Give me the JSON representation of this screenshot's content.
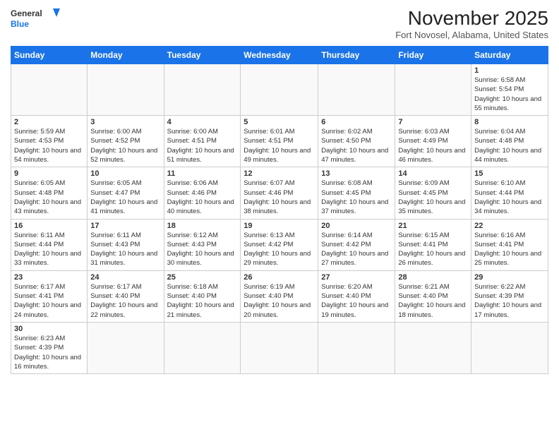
{
  "logo": {
    "line1": "General",
    "line2": "Blue"
  },
  "title": "November 2025",
  "location": "Fort Novosel, Alabama, United States",
  "days_of_week": [
    "Sunday",
    "Monday",
    "Tuesday",
    "Wednesday",
    "Thursday",
    "Friday",
    "Saturday"
  ],
  "weeks": [
    [
      {
        "day": "",
        "info": ""
      },
      {
        "day": "",
        "info": ""
      },
      {
        "day": "",
        "info": ""
      },
      {
        "day": "",
        "info": ""
      },
      {
        "day": "",
        "info": ""
      },
      {
        "day": "",
        "info": ""
      },
      {
        "day": "1",
        "info": "Sunrise: 6:58 AM\nSunset: 5:54 PM\nDaylight: 10 hours and 55 minutes."
      }
    ],
    [
      {
        "day": "2",
        "info": "Sunrise: 5:59 AM\nSunset: 4:53 PM\nDaylight: 10 hours and 54 minutes."
      },
      {
        "day": "3",
        "info": "Sunrise: 6:00 AM\nSunset: 4:52 PM\nDaylight: 10 hours and 52 minutes."
      },
      {
        "day": "4",
        "info": "Sunrise: 6:00 AM\nSunset: 4:51 PM\nDaylight: 10 hours and 51 minutes."
      },
      {
        "day": "5",
        "info": "Sunrise: 6:01 AM\nSunset: 4:51 PM\nDaylight: 10 hours and 49 minutes."
      },
      {
        "day": "6",
        "info": "Sunrise: 6:02 AM\nSunset: 4:50 PM\nDaylight: 10 hours and 47 minutes."
      },
      {
        "day": "7",
        "info": "Sunrise: 6:03 AM\nSunset: 4:49 PM\nDaylight: 10 hours and 46 minutes."
      },
      {
        "day": "8",
        "info": "Sunrise: 6:04 AM\nSunset: 4:48 PM\nDaylight: 10 hours and 44 minutes."
      }
    ],
    [
      {
        "day": "9",
        "info": "Sunrise: 6:05 AM\nSunset: 4:48 PM\nDaylight: 10 hours and 43 minutes."
      },
      {
        "day": "10",
        "info": "Sunrise: 6:05 AM\nSunset: 4:47 PM\nDaylight: 10 hours and 41 minutes."
      },
      {
        "day": "11",
        "info": "Sunrise: 6:06 AM\nSunset: 4:46 PM\nDaylight: 10 hours and 40 minutes."
      },
      {
        "day": "12",
        "info": "Sunrise: 6:07 AM\nSunset: 4:46 PM\nDaylight: 10 hours and 38 minutes."
      },
      {
        "day": "13",
        "info": "Sunrise: 6:08 AM\nSunset: 4:45 PM\nDaylight: 10 hours and 37 minutes."
      },
      {
        "day": "14",
        "info": "Sunrise: 6:09 AM\nSunset: 4:45 PM\nDaylight: 10 hours and 35 minutes."
      },
      {
        "day": "15",
        "info": "Sunrise: 6:10 AM\nSunset: 4:44 PM\nDaylight: 10 hours and 34 minutes."
      }
    ],
    [
      {
        "day": "16",
        "info": "Sunrise: 6:11 AM\nSunset: 4:44 PM\nDaylight: 10 hours and 33 minutes."
      },
      {
        "day": "17",
        "info": "Sunrise: 6:11 AM\nSunset: 4:43 PM\nDaylight: 10 hours and 31 minutes."
      },
      {
        "day": "18",
        "info": "Sunrise: 6:12 AM\nSunset: 4:43 PM\nDaylight: 10 hours and 30 minutes."
      },
      {
        "day": "19",
        "info": "Sunrise: 6:13 AM\nSunset: 4:42 PM\nDaylight: 10 hours and 29 minutes."
      },
      {
        "day": "20",
        "info": "Sunrise: 6:14 AM\nSunset: 4:42 PM\nDaylight: 10 hours and 27 minutes."
      },
      {
        "day": "21",
        "info": "Sunrise: 6:15 AM\nSunset: 4:41 PM\nDaylight: 10 hours and 26 minutes."
      },
      {
        "day": "22",
        "info": "Sunrise: 6:16 AM\nSunset: 4:41 PM\nDaylight: 10 hours and 25 minutes."
      }
    ],
    [
      {
        "day": "23",
        "info": "Sunrise: 6:17 AM\nSunset: 4:41 PM\nDaylight: 10 hours and 24 minutes."
      },
      {
        "day": "24",
        "info": "Sunrise: 6:17 AM\nSunset: 4:40 PM\nDaylight: 10 hours and 22 minutes."
      },
      {
        "day": "25",
        "info": "Sunrise: 6:18 AM\nSunset: 4:40 PM\nDaylight: 10 hours and 21 minutes."
      },
      {
        "day": "26",
        "info": "Sunrise: 6:19 AM\nSunset: 4:40 PM\nDaylight: 10 hours and 20 minutes."
      },
      {
        "day": "27",
        "info": "Sunrise: 6:20 AM\nSunset: 4:40 PM\nDaylight: 10 hours and 19 minutes."
      },
      {
        "day": "28",
        "info": "Sunrise: 6:21 AM\nSunset: 4:40 PM\nDaylight: 10 hours and 18 minutes."
      },
      {
        "day": "29",
        "info": "Sunrise: 6:22 AM\nSunset: 4:39 PM\nDaylight: 10 hours and 17 minutes."
      }
    ],
    [
      {
        "day": "30",
        "info": "Sunrise: 6:23 AM\nSunset: 4:39 PM\nDaylight: 10 hours and 16 minutes."
      },
      {
        "day": "",
        "info": ""
      },
      {
        "day": "",
        "info": ""
      },
      {
        "day": "",
        "info": ""
      },
      {
        "day": "",
        "info": ""
      },
      {
        "day": "",
        "info": ""
      },
      {
        "day": "",
        "info": ""
      }
    ]
  ]
}
